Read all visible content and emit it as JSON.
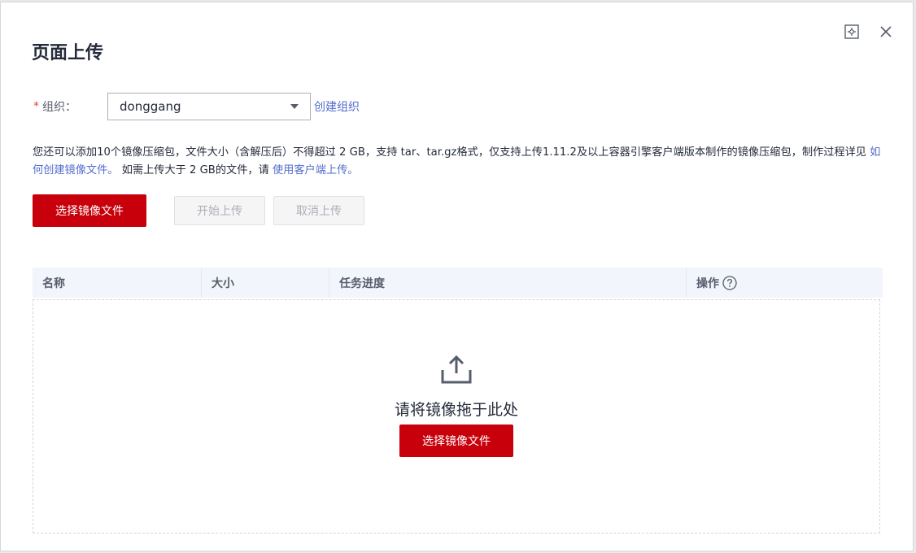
{
  "dialog": {
    "title": "页面上传",
    "icons": [
      "fullscreen-icon",
      "close-icon"
    ]
  },
  "org": {
    "required_mark": "*",
    "label": "组织：",
    "selected_value": "donggang",
    "create_link": "创建组织"
  },
  "description": {
    "text_part1": "您还可以添加10个镜像压缩包，文件大小（含解压后）不得超过 2 GB，支持 tar、tar.gz格式，仅支持上传1.11.2及以上容器引擎客户端版本制作的镜像压缩包，制作过程详见 ",
    "link1": "如何创建镜像文件。",
    "text_part2": " 如需上传大于 2 GB的文件，请 ",
    "link2": "使用客户端上传。"
  },
  "buttons": {
    "select_file": "选择镜像文件",
    "start_upload": "开始上传",
    "cancel_upload": "取消上传"
  },
  "table": {
    "columns": [
      "名称",
      "大小",
      "任务进度",
      "操作"
    ]
  },
  "dropzone": {
    "hint": "请将镜像拖于此处",
    "button_label": "选择镜像文件"
  },
  "colors": {
    "primary": "#c7000b",
    "link": "#526ecc",
    "required": "#e54545",
    "table_header_bg": "#f3f5fc"
  }
}
